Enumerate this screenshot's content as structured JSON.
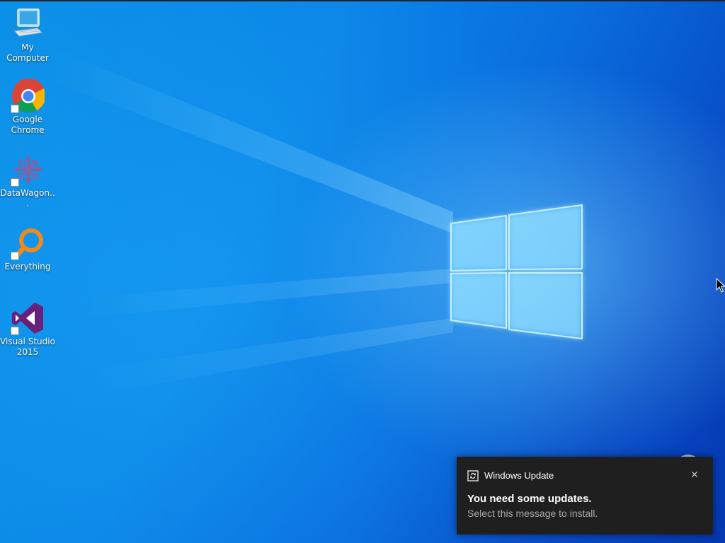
{
  "desktop": {
    "icons": [
      {
        "label": "My Computer",
        "icon": "computer-icon"
      },
      {
        "label": "Google Chrome",
        "icon": "chrome-icon"
      },
      {
        "label": "DataWagon...",
        "icon": "datawagon-icon"
      },
      {
        "label": "Everything",
        "icon": "everything-search-icon"
      },
      {
        "label": "Visual Studio 2015",
        "icon": "visual-studio-icon"
      }
    ]
  },
  "toast": {
    "app_name": "Windows Update",
    "title": "You need some updates.",
    "body": "Select this message to install.",
    "close_glyph": "✕",
    "app_icon": "update-sync-icon"
  },
  "colors": {
    "wallpaper_light": "#1aa3f0",
    "wallpaper_dark": "#0538b0",
    "toast_bg": "#1f1f1f",
    "toast_secondary_text": "#a9a9a9",
    "vs_purple": "#68217a",
    "everything_orange": "#f08a1c"
  }
}
